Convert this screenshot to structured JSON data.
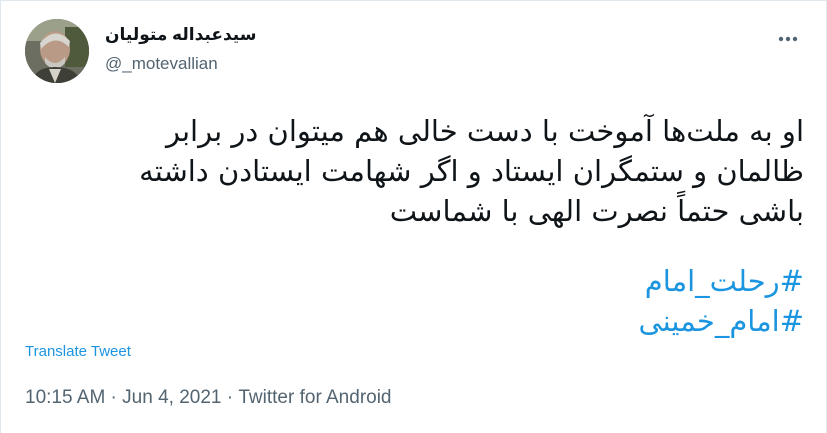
{
  "user": {
    "display_name": "سیدعبداله متولیان",
    "handle": "@_motevallian",
    "avatar_icon": "profile-photo"
  },
  "menu": {
    "more_icon": "more-dots-icon"
  },
  "tweet": {
    "lines": [
      "او به ملت‌ها آموخت با دست خالی هم میتوان در برابر",
      "ظالمان و ستمگران ایستاد و اگر شهامت ایستادن داشته",
      "باشی حتماً نصرت الهی با شماست"
    ],
    "hashtags": [
      "#رحلت_امام",
      "#امام_خمینی"
    ]
  },
  "translate_label": "Translate Tweet",
  "meta": {
    "time": "10:15 AM",
    "separator": " · ",
    "date": "Jun 4, 2021",
    "source": "Twitter for Android"
  },
  "colors": {
    "link": "#1b95e0",
    "muted": "#536471",
    "text": "#0f1419"
  }
}
